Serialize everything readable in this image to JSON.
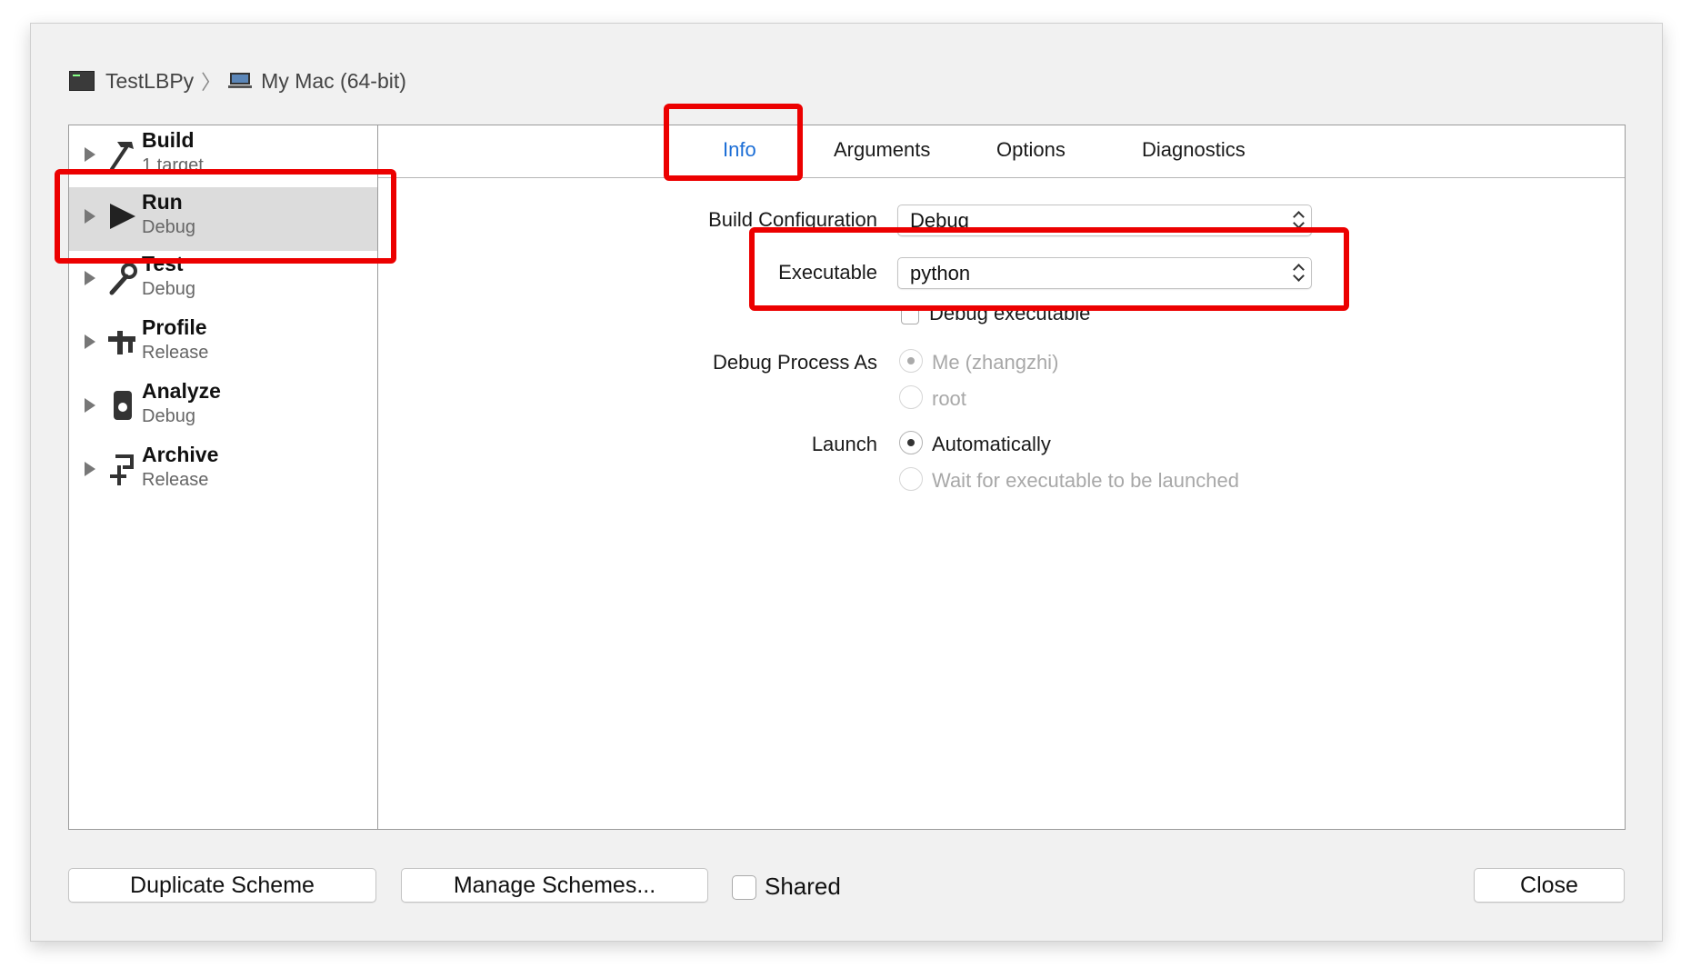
{
  "breadcrumb": {
    "scheme": "TestLBPy",
    "destination": "My Mac (64-bit)",
    "scheme_icon": "terminal-app-icon",
    "destination_icon": "laptop-icon"
  },
  "sidebar": {
    "items": [
      {
        "title": "Build",
        "subtitle": "1 target",
        "icon": "hammer-icon"
      },
      {
        "title": "Run",
        "subtitle": "Debug",
        "icon": "play-icon"
      },
      {
        "title": "Test",
        "subtitle": "Debug",
        "icon": "wrench-icon"
      },
      {
        "title": "Profile",
        "subtitle": "Release",
        "icon": "profile-icon"
      },
      {
        "title": "Analyze",
        "subtitle": "Debug",
        "icon": "analyze-icon"
      },
      {
        "title": "Archive",
        "subtitle": "Release",
        "icon": "archive-icon"
      }
    ],
    "selected": "Run"
  },
  "tabs": [
    {
      "label": "Info",
      "active": true
    },
    {
      "label": "Arguments",
      "active": false
    },
    {
      "label": "Options",
      "active": false
    },
    {
      "label": "Diagnostics",
      "active": false
    }
  ],
  "form": {
    "build_configuration": {
      "label": "Build Configuration",
      "value": "Debug"
    },
    "executable": {
      "label": "Executable",
      "value": "python"
    },
    "debug_executable": {
      "label": "Debug executable",
      "checked": false
    },
    "debug_process_as": {
      "label": "Debug Process As",
      "options": [
        {
          "label": "Me (zhangzhi)",
          "selected": true,
          "enabled": false
        },
        {
          "label": "root",
          "selected": false,
          "enabled": false
        }
      ]
    },
    "launch": {
      "label": "Launch",
      "options": [
        {
          "label": "Automatically",
          "selected": true,
          "enabled": true
        },
        {
          "label": "Wait for executable to be launched",
          "selected": false,
          "enabled": false
        }
      ]
    }
  },
  "footer": {
    "duplicate_label": "Duplicate Scheme",
    "manage_label": "Manage Schemes...",
    "shared_label": "Shared",
    "shared_checked": false,
    "close_label": "Close"
  },
  "colors": {
    "highlight": "#ec0000",
    "active_tab": "#1c6ed6",
    "selected_row": "#dcdcdc"
  }
}
